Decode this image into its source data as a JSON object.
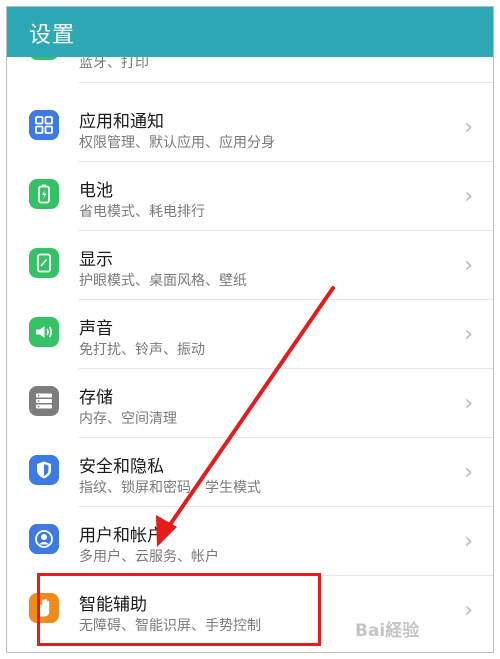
{
  "header": {
    "title": "设置"
  },
  "rows": [
    {
      "subtitle": "蓝牙、打印"
    },
    {
      "title": "应用和通知",
      "subtitle": "权限管理、默认应用、应用分身",
      "icon": "apps-grid-icon",
      "color": "#3d7be0"
    },
    {
      "title": "电池",
      "subtitle": "省电模式、耗电排行",
      "icon": "battery-icon",
      "color": "#35c266"
    },
    {
      "title": "显示",
      "subtitle": "护眼模式、桌面风格、壁纸",
      "icon": "display-icon",
      "color": "#35c266"
    },
    {
      "title": "声音",
      "subtitle": "免打扰、铃声、振动",
      "icon": "speaker-icon",
      "color": "#35c266"
    },
    {
      "title": "存储",
      "subtitle": "内存、空间清理",
      "icon": "storage-icon",
      "color": "#7d7d7d"
    },
    {
      "title": "安全和隐私",
      "subtitle": "指纹、锁屏和密码、学生模式",
      "icon": "shield-icon",
      "color": "#3d7be0"
    },
    {
      "title": "用户和帐户",
      "subtitle": "多用户、云服务、帐户",
      "icon": "user-icon",
      "color": "#3d7be0"
    },
    {
      "title": "智能辅助",
      "subtitle": "无障碍、智能识屏、手势控制",
      "icon": "hand-icon",
      "color": "#f08a1c"
    }
  ],
  "chevron": "›",
  "annotation": {
    "color": "#e41c1c"
  },
  "watermark": "Bai経验"
}
